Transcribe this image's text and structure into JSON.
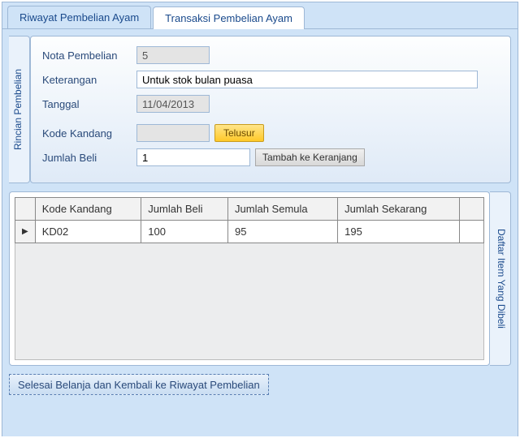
{
  "tabs": {
    "history": "Riwayat Pembelian Ayam",
    "transaction": "Transaksi Pembelian Ayam"
  },
  "sideTabs": {
    "rincian": "Rincian Pembelian",
    "daftar": "Daftar Item Yang Dibeli"
  },
  "form": {
    "labels": {
      "nota": "Nota Pembelian",
      "keterangan": "Keterangan",
      "tanggal": "Tanggal",
      "kodeKandang": "Kode Kandang",
      "jumlahBeli": "Jumlah Beli"
    },
    "values": {
      "nota": "5",
      "keterangan": "Untuk stok bulan puasa",
      "tanggal": "11/04/2013",
      "kodeKandang": "",
      "jumlahBeli": "1"
    },
    "buttons": {
      "telusur": "Telusur",
      "tambah": "Tambah ke Keranjang"
    }
  },
  "grid": {
    "headers": {
      "kodeKandang": "Kode Kandang",
      "jumlahBeli": "Jumlah Beli",
      "jumlahSemula": "Jumlah Semula",
      "jumlahSekarang": "Jumlah Sekarang"
    },
    "rows": [
      {
        "kodeKandang": "KD02",
        "jumlahBeli": "100",
        "jumlahSemula": "95",
        "jumlahSekarang": "195"
      }
    ]
  },
  "footer": {
    "finish": "Selesai Belanja dan Kembali ke Riwayat Pembelian"
  }
}
